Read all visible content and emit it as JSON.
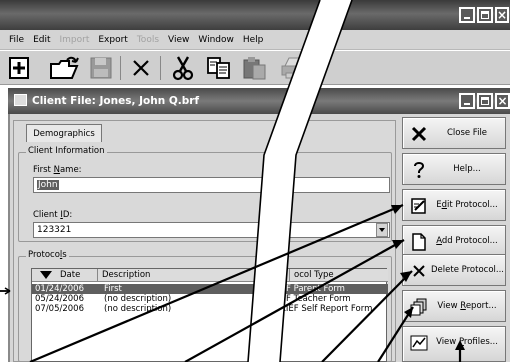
{
  "menu": {
    "items": [
      {
        "label": "File",
        "enabled": true
      },
      {
        "label": "Edit",
        "enabled": true
      },
      {
        "label": "Import",
        "enabled": false
      },
      {
        "label": "Export",
        "enabled": true
      },
      {
        "label": "Tools",
        "enabled": false
      },
      {
        "label": "View",
        "enabled": true
      },
      {
        "label": "Window",
        "enabled": true
      },
      {
        "label": "Help",
        "enabled": true
      }
    ]
  },
  "window": {
    "title": "Client File: Jones, John Q.brf"
  },
  "form": {
    "tab_label": "Demographics",
    "client_info_legend": "Client Information",
    "first_name_label_pre": "First ",
    "first_name_label_accel": "N",
    "first_name_label_post": "ame:",
    "first_name_value": "John",
    "client_id_label_pre": "Client ",
    "client_id_label_accel": "I",
    "client_id_label_post": "D:",
    "client_id_value": "123321",
    "protocols_legend_pre": "Protoco",
    "protocols_legend_accel": "l",
    "protocols_legend_post": "s"
  },
  "protocols": {
    "columns": {
      "date": "Date",
      "description": "Description",
      "type": "ocol Type"
    },
    "rows": [
      {
        "date": "01/24/2006",
        "description": "First",
        "type": "F Parent Form",
        "selected": true
      },
      {
        "date": "05/24/2006",
        "description": "(no description)",
        "type": "F Teacher Form",
        "selected": false
      },
      {
        "date": "07/05/2006",
        "description": "(no description)",
        "type": "RIEF Self Report Form",
        "selected": false
      }
    ]
  },
  "sidebar": {
    "close_file": "Close File",
    "help": "Help...",
    "edit_protocol_accel": "d",
    "edit_protocol_pre": "E",
    "edit_protocol_post": "it Protocol...",
    "add_protocol_accel": "A",
    "add_protocol_post": "dd Protocol...",
    "delete_protocol": "Delete Protocol...",
    "view_report_pre": "View ",
    "view_report_accel": "R",
    "view_report_post": "eport...",
    "view_profiles_pre": "View ",
    "view_profiles_accel": "P",
    "view_profiles_post": "rofiles..."
  },
  "colors": {
    "titlebar": "#4a4a4a",
    "selection": "#5f5f5f",
    "panel": "#d9d9d9"
  },
  "icons": [
    "new-document-icon",
    "open-folder-icon",
    "save-disk-icon",
    "delete-x-icon",
    "cut-scissors-icon",
    "copy-icon",
    "paste-icon",
    "print-icon",
    "sort-arrow-icon"
  ]
}
